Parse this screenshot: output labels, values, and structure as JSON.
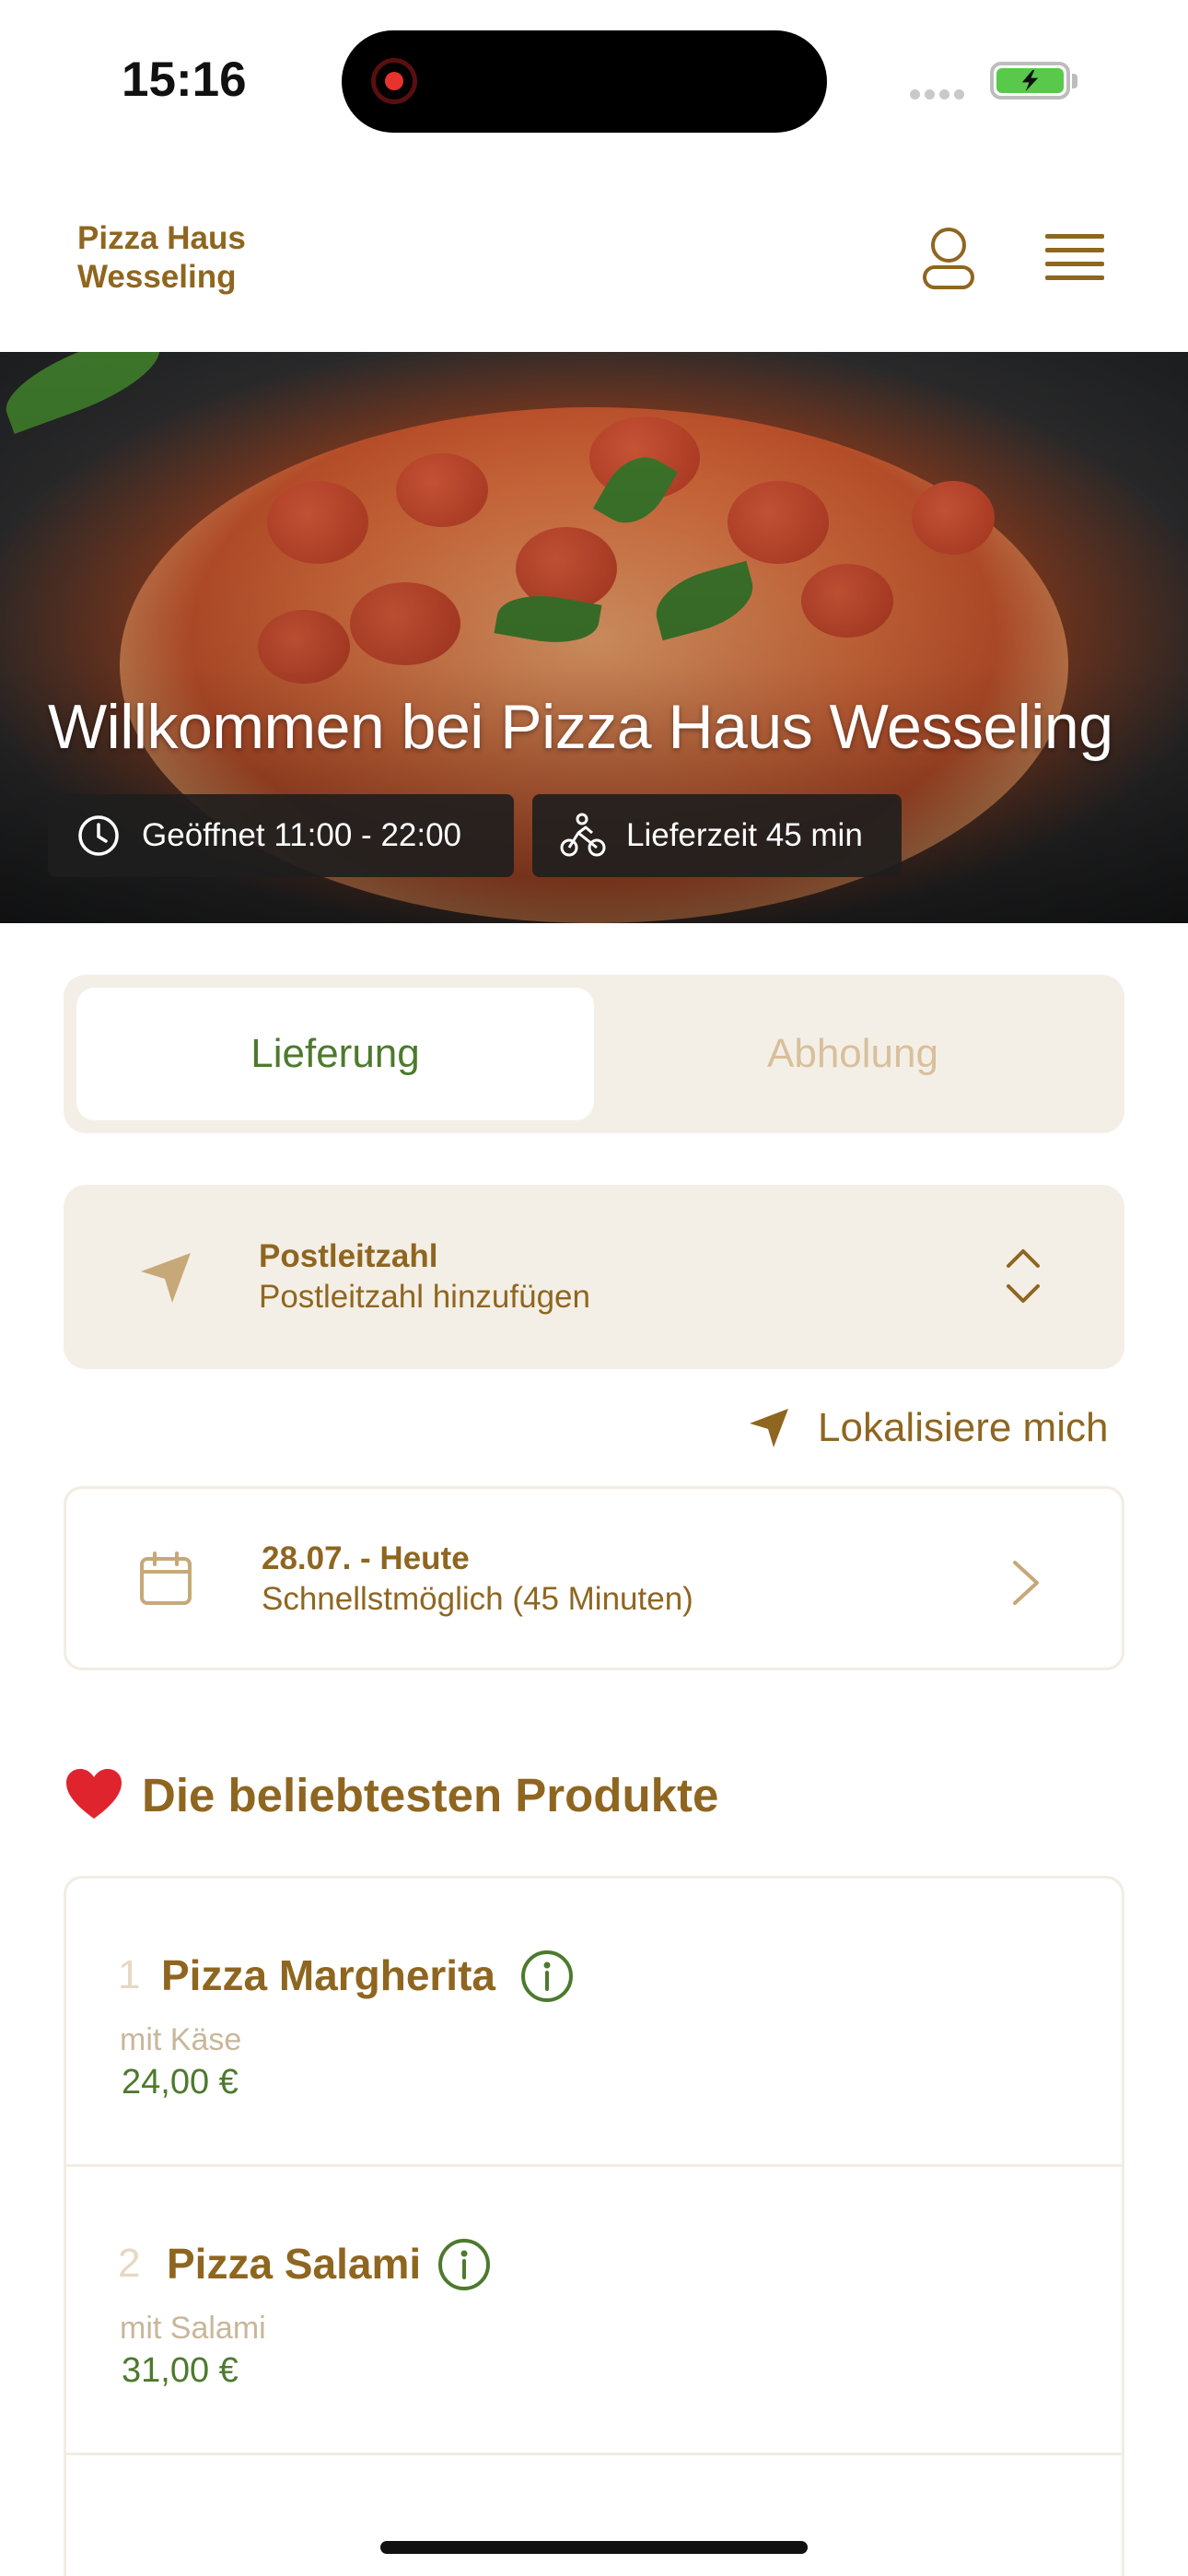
{
  "status_bar": {
    "time": "15:16"
  },
  "header": {
    "brand": "Pizza Haus Wesseling"
  },
  "hero": {
    "title": "Willkommen bei Pizza Haus Wesseling",
    "opening_hours": "Geöffnet 11:00 - 22:00",
    "delivery_time": "Lieferzeit 45 min"
  },
  "tabs": [
    {
      "label": "Lieferung",
      "active": true
    },
    {
      "label": "Abholung",
      "active": false
    }
  ],
  "postcode": {
    "label": "Postleitzahl",
    "value": "Postleitzahl hinzufügen"
  },
  "locate": {
    "label": "Lokalisiere mich"
  },
  "date": {
    "label": "28.07. - Heute",
    "value": "Schnellstmöglich (45 Minuten)"
  },
  "popular": {
    "title": "Die beliebtesten Produkte",
    "items": [
      {
        "rank": "1",
        "name": "Pizza Margherita",
        "desc": "mit Käse",
        "price": "24,00 €"
      },
      {
        "rank": "2",
        "name": "Pizza Salami",
        "desc": "mit Salami",
        "price": "31,00 €"
      }
    ]
  },
  "colors": {
    "accent": "#8f6620",
    "green": "#4d7a2e",
    "panel": "#f4efe6"
  }
}
